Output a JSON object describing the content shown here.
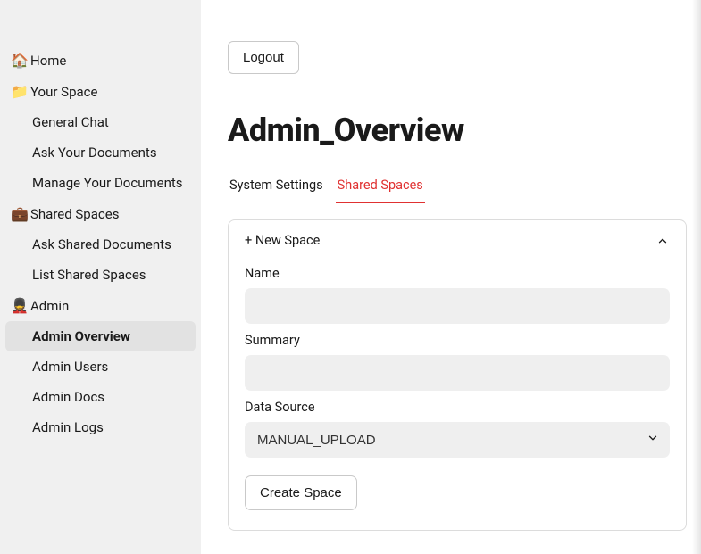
{
  "sidebar": {
    "home": {
      "label": "Home",
      "icon": "🏠"
    },
    "yourSpace": {
      "label": "Your Space",
      "icon": "📁",
      "children": [
        {
          "label": "General Chat"
        },
        {
          "label": "Ask Your Documents"
        },
        {
          "label": "Manage Your Documents"
        }
      ]
    },
    "sharedSpaces": {
      "label": "Shared Spaces",
      "icon": "💼",
      "children": [
        {
          "label": "Ask Shared Documents"
        },
        {
          "label": "List Shared Spaces"
        }
      ]
    },
    "admin": {
      "label": "Admin",
      "icon": "💂",
      "children": [
        {
          "label": "Admin Overview",
          "active": true
        },
        {
          "label": "Admin Users"
        },
        {
          "label": "Admin Docs"
        },
        {
          "label": "Admin Logs"
        }
      ]
    }
  },
  "header": {
    "logout_label": "Logout"
  },
  "page": {
    "title": "Admin_Overview"
  },
  "tabs": [
    {
      "label": "System Settings",
      "active": false
    },
    {
      "label": "Shared Spaces",
      "active": true
    }
  ],
  "panel": {
    "title": "+ New Space",
    "expanded": true,
    "fields": {
      "name": {
        "label": "Name",
        "value": ""
      },
      "summary": {
        "label": "Summary",
        "value": ""
      },
      "dataSource": {
        "label": "Data Source",
        "value": "MANUAL_UPLOAD",
        "options": [
          "MANUAL_UPLOAD"
        ]
      }
    },
    "submit_label": "Create Space"
  }
}
